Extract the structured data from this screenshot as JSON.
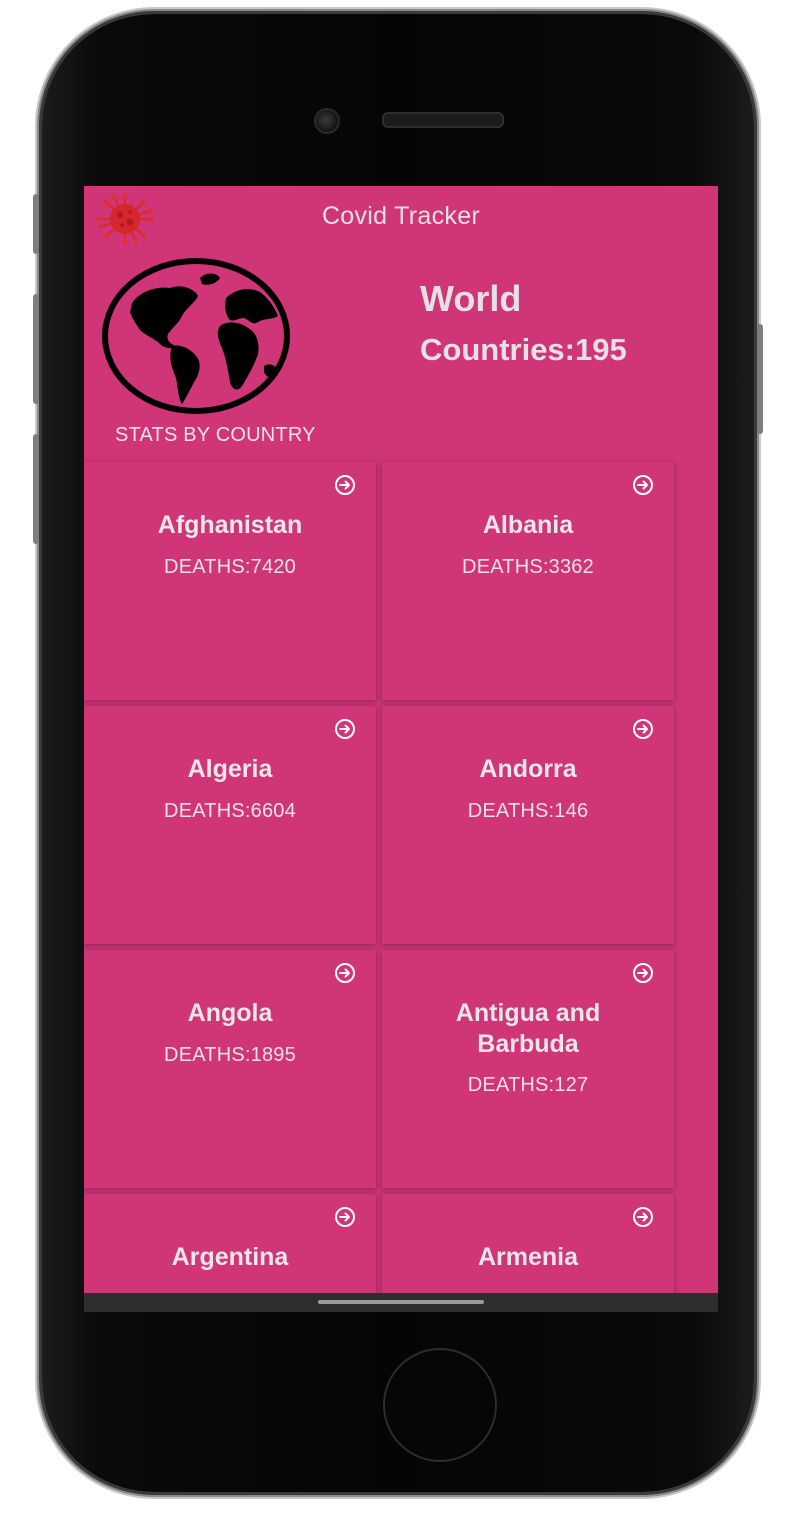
{
  "app": {
    "title": "Covid Tracker",
    "brand_color": "#cf3577",
    "logo_icon": "virus-icon"
  },
  "header": {
    "world_label": "World",
    "countries_text": "Countries:195",
    "section_label": "STATS BY COUNTRY",
    "globe_icon": "globe-icon"
  },
  "countries": [
    {
      "name": "Afghanistan",
      "deaths": "DEATHS:7420"
    },
    {
      "name": "Albania",
      "deaths": "DEATHS:3362"
    },
    {
      "name": "Algeria",
      "deaths": "DEATHS:6604"
    },
    {
      "name": "Andorra",
      "deaths": "DEATHS:146"
    },
    {
      "name": "Angola",
      "deaths": "DEATHS:1895"
    },
    {
      "name": "Antigua and Barbuda",
      "deaths": "DEATHS:127"
    },
    {
      "name": "Argentina",
      "deaths": ""
    },
    {
      "name": "Armenia",
      "deaths": ""
    }
  ],
  "card_icon": "arrow-right-circle-icon"
}
